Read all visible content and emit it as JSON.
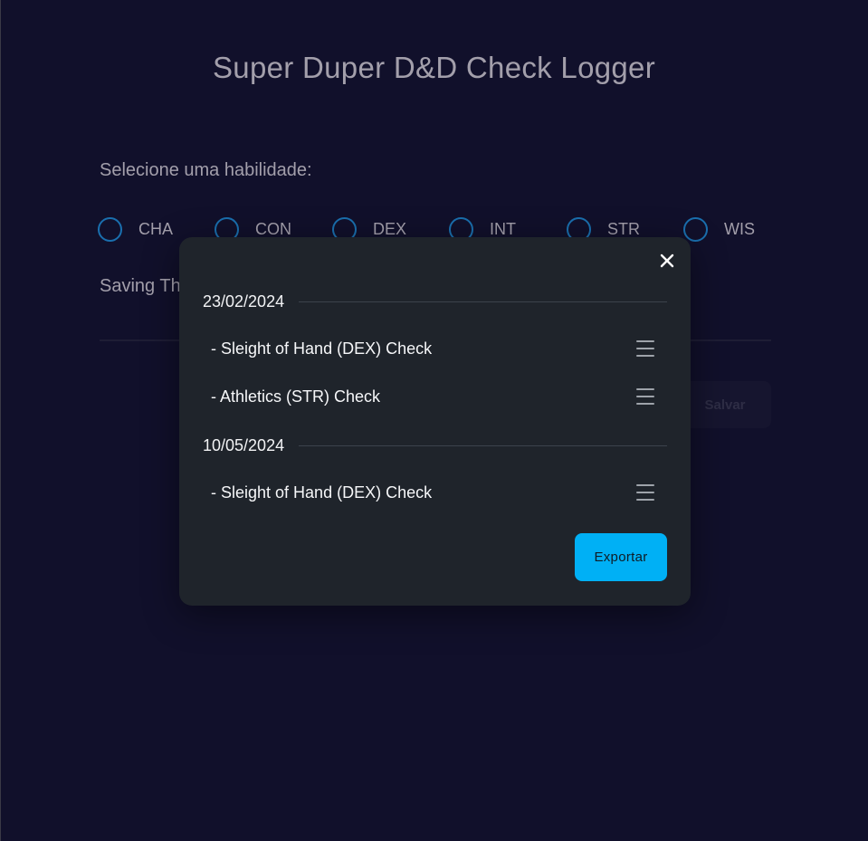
{
  "app": {
    "title": "Super Duper D&D Check Logger"
  },
  "form": {
    "ability_prompt": "Selecione uma habilidade:",
    "abilities": [
      "CHA",
      "CON",
      "DEX",
      "INT",
      "STR",
      "WIS"
    ],
    "saving_label": "Saving Th",
    "save_button": "Salvar"
  },
  "modal": {
    "close_glyph": "✕",
    "groups": [
      {
        "date": "23/02/2024",
        "entries": [
          "- Sleight of Hand (DEX) Check",
          "- Athletics (STR) Check"
        ]
      },
      {
        "date": "10/05/2024",
        "entries": [
          "- Sleight of Hand (DEX) Check"
        ]
      }
    ],
    "export_button": "Exportar"
  },
  "colors": {
    "background": "#11102b",
    "modal_background": "#1f242b",
    "radio_accent": "#1a6fae",
    "export_button": "#00b0f5"
  },
  "icons": {
    "close": "close-icon",
    "entry_menu": "menu-icon",
    "radio": "radio-unchecked-icon"
  }
}
